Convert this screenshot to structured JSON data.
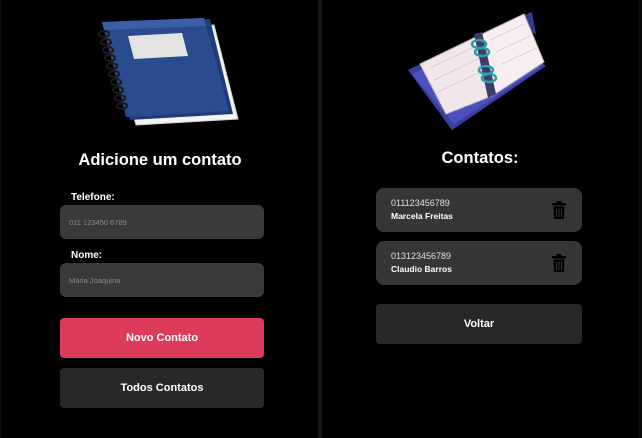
{
  "add_screen": {
    "title": "Adicione um contato",
    "phone_label": "Telefone:",
    "phone_placeholder": "011 123450 6789",
    "phone_value": "",
    "name_label": "Nome:",
    "name_placeholder": "Maria Joaquina",
    "name_value": "",
    "new_contact_button": "Novo Contato",
    "all_contacts_button": "Todos Contatos"
  },
  "list_screen": {
    "title": "Contatos:",
    "contacts": [
      {
        "phone": "011123456789",
        "name": "Marcela Freitas",
        "icon": "trash-icon"
      },
      {
        "phone": "013123456789",
        "name": "Claudio Barros",
        "icon": "trash-icon"
      }
    ],
    "back_button": "Voltar"
  },
  "colors": {
    "background": "#000000",
    "input_bg": "#3a3a3a",
    "primary_button": "#dc3b5c",
    "secondary_button": "#282828",
    "card_bg": "#363636",
    "text": "#ffffff"
  },
  "icons": {
    "notebook": "notebook-icon",
    "agenda": "agenda-icon"
  }
}
